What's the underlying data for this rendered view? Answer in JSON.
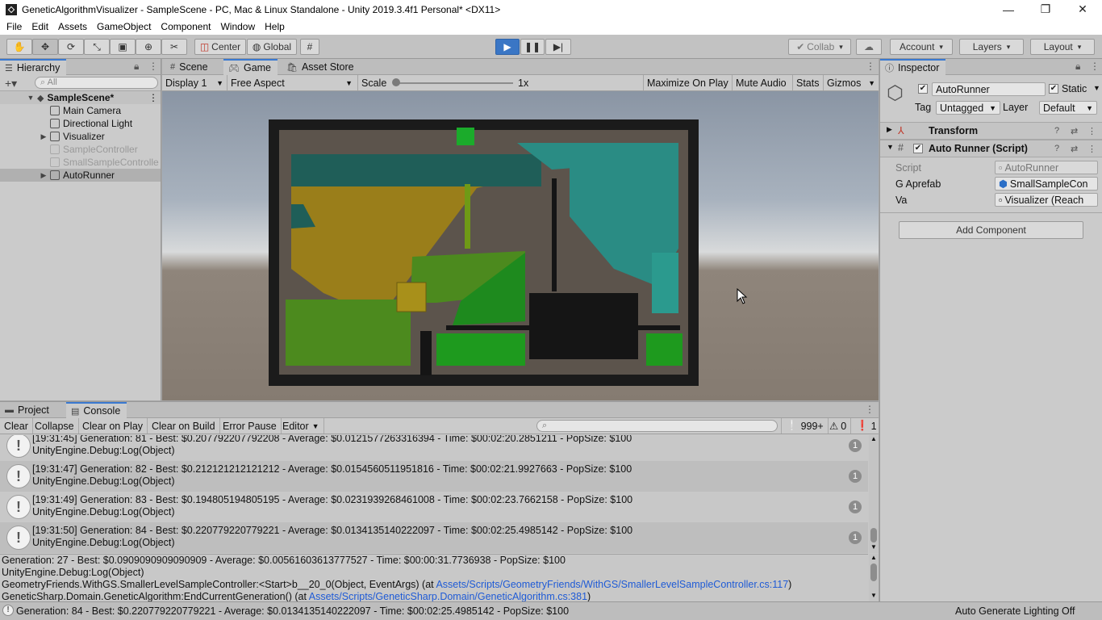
{
  "window": {
    "title": "GeneticAlgorithmVisualizer - SampleScene - PC, Mac & Linux Standalone - Unity 2019.3.4f1 Personal* <DX11>",
    "minimize": "—",
    "restore": "❐",
    "close": "✕"
  },
  "menu": [
    "File",
    "Edit",
    "Assets",
    "GameObject",
    "Component",
    "Window",
    "Help"
  ],
  "toolbar": {
    "tools": [
      "hand-tool",
      "move-tool",
      "rotate-tool",
      "scale-tool",
      "rect-tool",
      "transform-tool",
      "custom-tool"
    ],
    "pivot": "Center",
    "space": "Global",
    "collab": "Collab",
    "account": "Account",
    "layers": "Layers",
    "layout": "Layout"
  },
  "hierarchy": {
    "tab": "Hierarchy",
    "search_placeholder": "All",
    "scene": "SampleScene*",
    "items": [
      {
        "label": "Main Camera"
      },
      {
        "label": "Directional Light"
      },
      {
        "label": "Visualizer"
      },
      {
        "label": "SampleController"
      },
      {
        "label": "SmallSampleControlle"
      },
      {
        "label": "AutoRunner"
      }
    ]
  },
  "center_tabs": [
    "Scene",
    "Game",
    "Asset Store"
  ],
  "game_bar": {
    "display": "Display 1",
    "aspect": "Free Aspect",
    "scale_label": "Scale",
    "scale_value": "1x",
    "scale_fraction": 0.0,
    "maximize": "Maximize On Play",
    "mute": "Mute Audio",
    "stats": "Stats",
    "gizmos": "Gizmos"
  },
  "inspector": {
    "tab": "Inspector",
    "object_name": "AutoRunner",
    "static_label": "Static",
    "tag_label": "Tag",
    "tag_value": "Untagged",
    "layer_label": "Layer",
    "layer_value": "Default",
    "transform": "Transform",
    "component": "Auto Runner (Script)",
    "fields": [
      {
        "label": "Script",
        "value": "AutoRunner"
      },
      {
        "label": "G Aprefab",
        "value": "SmallSampleCon"
      },
      {
        "label": "Va",
        "value": "Visualizer (Reach"
      }
    ],
    "add_component": "Add Component"
  },
  "console": {
    "tabs": [
      "Project",
      "Console"
    ],
    "buttons": [
      "Clear",
      "Collapse",
      "Clear on Play",
      "Clear on Build",
      "Error Pause",
      "Editor"
    ],
    "counts": {
      "info": "999+",
      "warn": "0",
      "error": "1"
    },
    "logs": [
      {
        "line1": "[19:31:45] Generation: 81 - Best: $0.207792207792208 - Average: $0.0121577263316394 - Time: $00:02:20.2851211 - PopSize: $100",
        "line2": "UnityEngine.Debug:Log(Object)",
        "count": "1"
      },
      {
        "line1": "[19:31:47] Generation: 82 - Best: $0.212121212121212 - Average: $0.0154560511951816 - Time: $00:02:21.9927663 - PopSize: $100",
        "line2": "UnityEngine.Debug:Log(Object)",
        "count": "1"
      },
      {
        "line1": "[19:31:49] Generation: 83 - Best: $0.194805194805195 - Average: $0.0231939268461008 - Time: $00:02:23.7662158 - PopSize: $100",
        "line2": "UnityEngine.Debug:Log(Object)",
        "count": "1"
      },
      {
        "line1": "[19:31:50] Generation: 84 - Best: $0.220779220779221 - Average: $0.0134135140222097 - Time: $00:02:25.4985142 - PopSize: $100",
        "line2": "UnityEngine.Debug:Log(Object)",
        "count": "1"
      }
    ],
    "detail": {
      "l1": "Generation: 27 - Best: $0.0909090909090909 - Average: $0.00561603613777527 - Time: $00:00:31.7736938 - PopSize: $100",
      "l2": "UnityEngine.Debug:Log(Object)",
      "l3_pre": "GeometryFriends.WithGS.SmallerLevelSampleController:<Start>b__20_0(Object, EventArgs) (at ",
      "l3_link": "Assets/Scripts/GeometryFriends/WithGS/SmallerLevelSampleController.cs:117",
      "l3_post": ")",
      "l4_pre": "GeneticSharp.Domain.GeneticAlgorithm:EndCurrentGeneration() (at ",
      "l4_link": "Assets/Scripts/GeneticSharp.Domain/GeneticAlgorithm.cs:381",
      "l4_post": ")"
    }
  },
  "status": {
    "message": "Generation: 84 - Best: $0.220779220779221 - Average: $0.0134135140222097 - Time: $00:02:25.4985142 - PopSize: $100",
    "right": "Auto Generate Lighting Off"
  }
}
